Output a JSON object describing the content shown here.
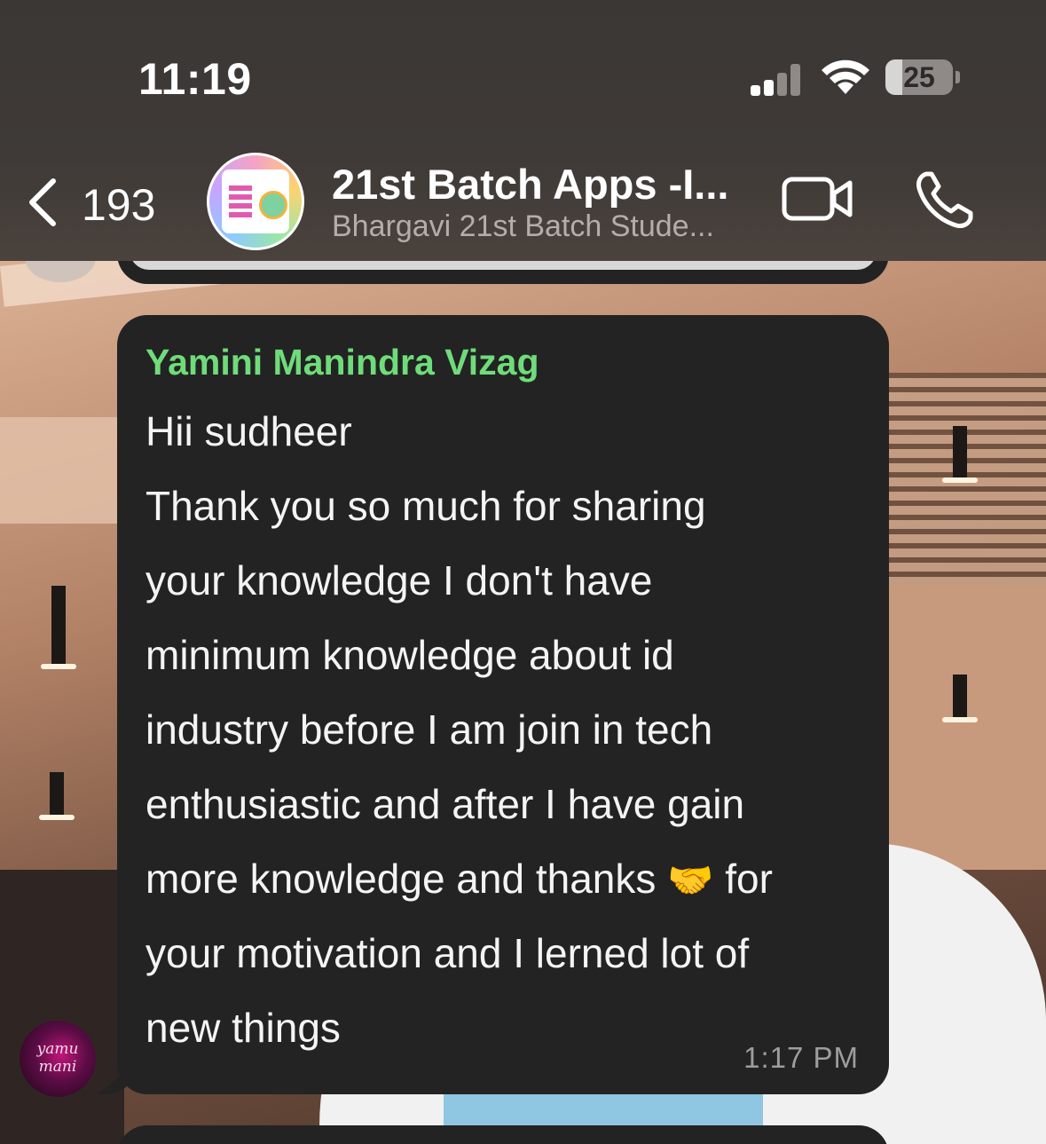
{
  "status_bar": {
    "time": "11:19",
    "battery_level": "25",
    "battery_fraction": 0.25,
    "signal_bars_active": 2,
    "signal_bars_total": 4
  },
  "header": {
    "back_count": "193",
    "group_name": "21st Batch Apps -I...",
    "subtitle": "Bhargavi 21st Batch Stude...",
    "icons": {
      "back": "chevron-left-icon",
      "video": "video-camera-icon",
      "phone": "phone-icon"
    }
  },
  "message": {
    "sender": "Yamini Manindra Vizag",
    "sender_color": "#6fdc7a",
    "lines": [
      "Hii sudheer",
      "Thank you so much for sharing",
      "your knowledge I don't have",
      "minimum knowledge about id",
      "industry before I am join in tech",
      "enthusiastic and after I have gain",
      "more knowledge and thanks",
      "your motivation and I lerned lot of",
      "new things"
    ],
    "emoji": "🤝",
    "emoji_trailing": " for",
    "time": "1:17 PM",
    "avatar_text": "yamu mani"
  },
  "colors": {
    "bubble": "#232323",
    "header": "#3f3a37",
    "text": "#f4f4f4",
    "timestamp": "#9d9d9d"
  }
}
